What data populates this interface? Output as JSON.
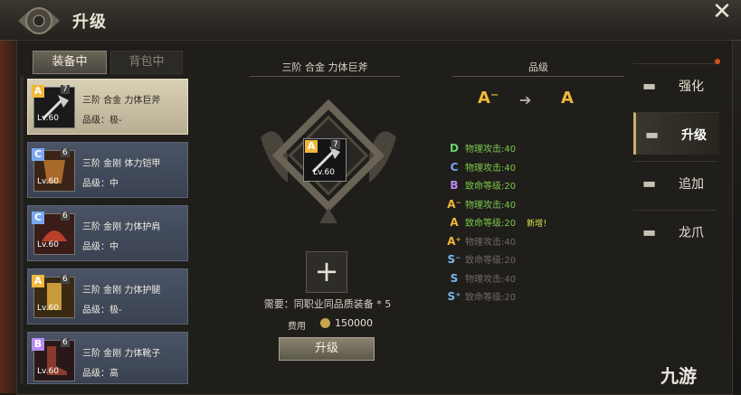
{
  "title": "升级",
  "tabs": [
    {
      "label": "装备中",
      "active": true
    },
    {
      "label": "背包中",
      "active": false
    }
  ],
  "items": [
    {
      "grade": "A",
      "grade_suffix": "-",
      "grade_color": "#f0b83a",
      "count": "7",
      "level": "Lv.60",
      "name": "三阶 合金 力体巨斧",
      "quality": "品级：极-",
      "selected": true,
      "icon": "axe-icon"
    },
    {
      "grade": "C",
      "grade_suffix": "",
      "grade_color": "#7aa8f0",
      "count": "6",
      "level": "Lv.60",
      "name": "三阶 金刚 体力铠甲",
      "quality": "品级：中",
      "selected": false,
      "icon": "armor-icon"
    },
    {
      "grade": "C",
      "grade_suffix": "",
      "grade_color": "#7aa8f0",
      "count": "6",
      "level": "Lv.60",
      "name": "三阶 金刚 力体护肩",
      "quality": "品级：中",
      "selected": false,
      "icon": "shoulder-icon"
    },
    {
      "grade": "A",
      "grade_suffix": "-",
      "grade_color": "#f0b83a",
      "count": "6",
      "level": "Lv.60",
      "name": "三阶 金刚 力体护腿",
      "quality": "品级：极-",
      "selected": false,
      "icon": "leg-icon"
    },
    {
      "grade": "B",
      "grade_suffix": "",
      "grade_color": "#b88af0",
      "count": "6",
      "level": "Lv.60",
      "name": "三阶 金刚 力体靴子",
      "quality": "品级：高",
      "selected": false,
      "icon": "boots-icon"
    }
  ],
  "center": {
    "item_title": "三阶 合金 力体巨斧",
    "slot": {
      "grade": "A",
      "grade_suffix": "-",
      "count": "7",
      "level": "Lv.60"
    },
    "requirement": "需要：同职业同品质装备 * 5",
    "cost_label": "费用",
    "cost_value": "150000",
    "upgrade_button": "升级"
  },
  "grade_panel": {
    "title": "品级",
    "from": "A⁻",
    "to": "A",
    "stats": [
      {
        "grade": "D",
        "color": "#6ad06a",
        "text": "物理攻击:40",
        "dim": false,
        "new": ""
      },
      {
        "grade": "C",
        "color": "#7aa8f0",
        "text": "物理攻击:40",
        "dim": false,
        "new": ""
      },
      {
        "grade": "B",
        "color": "#b88af0",
        "text": "致命等级:20",
        "dim": false,
        "new": ""
      },
      {
        "grade": "A⁻",
        "color": "#f0b83a",
        "text": "物理攻击:40",
        "dim": false,
        "new": ""
      },
      {
        "grade": "A",
        "color": "#f0b83a",
        "text": "致命等级:20",
        "dim": false,
        "new": "新增！"
      },
      {
        "grade": "A⁺",
        "color": "#f0b83a",
        "text": "物理攻击:40",
        "dim": true,
        "new": ""
      },
      {
        "grade": "S⁻",
        "color": "#7ab8f0",
        "text": "致命等级:20",
        "dim": true,
        "new": ""
      },
      {
        "grade": "S",
        "color": "#7ab8f0",
        "text": "物理攻击:40",
        "dim": true,
        "new": ""
      },
      {
        "grade": "S⁺",
        "color": "#7ab8f0",
        "text": "致命等级:20",
        "dim": true,
        "new": ""
      }
    ]
  },
  "menu": [
    {
      "label": "强化",
      "active": false
    },
    {
      "label": "升级",
      "active": true
    },
    {
      "label": "追加",
      "active": false
    },
    {
      "label": "龙爪",
      "active": false
    }
  ],
  "watermark": "九游"
}
